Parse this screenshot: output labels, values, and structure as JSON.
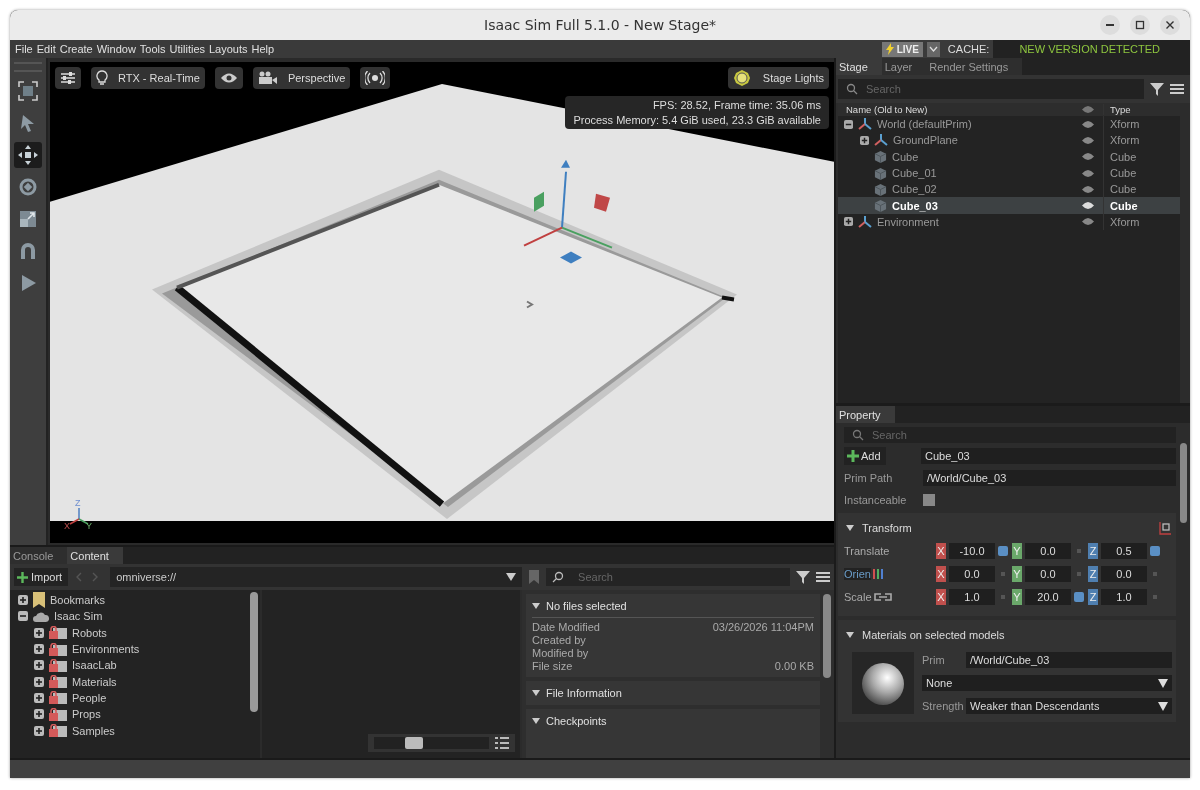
{
  "window": {
    "title": "Isaac Sim Full 5.1.0 - New Stage*"
  },
  "menu": [
    "File",
    "Edit",
    "Create",
    "Window",
    "Tools",
    "Utilities",
    "Layouts",
    "Help"
  ],
  "live": {
    "label": "LIVE"
  },
  "cache": {
    "label": "CACHE:",
    "status": "NEW VERSION DETECTED"
  },
  "tools": [
    {
      "kind": "frame",
      "selected": false
    },
    {
      "kind": "select",
      "selected": false
    },
    {
      "kind": "move",
      "selected": true
    },
    {
      "kind": "rotate",
      "selected": false
    },
    {
      "kind": "scale",
      "selected": false
    },
    {
      "kind": "snap",
      "selected": false
    },
    {
      "kind": "play",
      "selected": false
    }
  ],
  "viewport": {
    "toolbar": [
      {
        "kind": "settings"
      },
      {
        "kind": "render",
        "label": "RTX - Real-Time"
      },
      {
        "kind": "eye"
      },
      {
        "kind": "camera",
        "label": "Perspective"
      },
      {
        "kind": "audio"
      }
    ],
    "stage_lights": "Stage Lights",
    "stats": [
      "FPS: 28.52, Frame time: 35.06 ms",
      "Process Memory: 5.4 GiB used, 23.3 GiB available"
    ],
    "axes": [
      "X",
      "Y",
      "Z"
    ]
  },
  "stage": {
    "tabs": [
      {
        "label": "Stage",
        "selected": true
      },
      {
        "label": "Layer",
        "selected": false
      },
      {
        "label": "Render Settings",
        "selected": false
      }
    ],
    "search": {
      "placeholder": "Search"
    },
    "columns": [
      "Name (Old to New)",
      "Type"
    ],
    "tree": [
      {
        "name": "World (defaultPrim)",
        "type": "Xform",
        "kind": "xform",
        "expanded": true,
        "selected": false,
        "children": [
          {
            "name": "GroundPlane",
            "type": "Xform",
            "kind": "xform",
            "expanded": false,
            "selected": false
          },
          {
            "name": "Cube",
            "type": "Cube",
            "kind": "cube",
            "selected": false
          },
          {
            "name": "Cube_01",
            "type": "Cube",
            "kind": "cube",
            "selected": false
          },
          {
            "name": "Cube_02",
            "type": "Cube",
            "kind": "cube",
            "selected": false
          },
          {
            "name": "Cube_03",
            "type": "Cube",
            "kind": "cube",
            "selected": true
          }
        ]
      },
      {
        "name": "Environment",
        "type": "Xform",
        "kind": "xform",
        "expanded": false,
        "selected": false
      }
    ]
  },
  "property": {
    "tab": "Property",
    "search": {
      "placeholder": "Search"
    },
    "add": "Add",
    "name": "Cube_03",
    "prim_path_label": "Prim Path",
    "prim_path": "/World/Cube_03",
    "instanceable_label": "Instanceable",
    "instanceable": false,
    "transform": {
      "title": "Transform",
      "expanded": true,
      "rows": [
        {
          "label": "Translate",
          "kind": "plain",
          "fields": [
            {
              "axis": "X",
              "value": "-10.0",
              "color": "#c0504d",
              "changed": true
            },
            {
              "axis": "Y",
              "value": "0.0",
              "color": "#6aa86a",
              "changed": false
            },
            {
              "axis": "Z",
              "value": "0.5",
              "color": "#4f7fb0",
              "changed": true
            }
          ]
        },
        {
          "label": "Orien",
          "kind": "orient",
          "fields": [
            {
              "axis": "X",
              "value": "0.0",
              "color": "#c0504d",
              "changed": false
            },
            {
              "axis": "Y",
              "value": "0.0",
              "color": "#6aa86a",
              "changed": false
            },
            {
              "axis": "Z",
              "value": "0.0",
              "color": "#4f7fb0",
              "changed": false
            }
          ]
        },
        {
          "label": "Scale",
          "kind": "scale",
          "fields": [
            {
              "axis": "X",
              "value": "1.0",
              "color": "#c0504d",
              "changed": false
            },
            {
              "axis": "Y",
              "value": "20.0",
              "color": "#6aa86a",
              "changed": true
            },
            {
              "axis": "Z",
              "value": "1.0",
              "color": "#4f7fb0",
              "changed": false
            }
          ]
        }
      ]
    },
    "materials": {
      "title": "Materials on selected models",
      "expanded": true,
      "prim_label": "Prim",
      "prim": "/World/Cube_03",
      "material": "None",
      "strength_label": "Strength",
      "strength": "Weaker than Descendants"
    }
  },
  "content": {
    "tabs": [
      {
        "label": "Console",
        "selected": false
      },
      {
        "label": "Content",
        "selected": true
      }
    ],
    "import": "Import",
    "path": "omniverse://",
    "search": {
      "placeholder": "Search"
    },
    "tree": [
      {
        "name": "Bookmarks",
        "kind": "bookmark",
        "expanded": false
      },
      {
        "name": "Isaac Sim",
        "kind": "cloud",
        "expanded": true,
        "children": [
          {
            "name": "Robots",
            "kind": "folder",
            "expanded": false
          },
          {
            "name": "Environments",
            "kind": "folder",
            "expanded": false
          },
          {
            "name": "IsaacLab",
            "kind": "folder",
            "expanded": false
          },
          {
            "name": "Materials",
            "kind": "folder",
            "expanded": false
          },
          {
            "name": "People",
            "kind": "folder",
            "expanded": false
          },
          {
            "name": "Props",
            "kind": "folder",
            "expanded": false
          },
          {
            "name": "Samples",
            "kind": "folder",
            "expanded": false
          }
        ]
      }
    ],
    "thumbnail_size": {
      "level": 0.35
    },
    "details": {
      "title": "No files selected",
      "expanded": true,
      "rows": [
        {
          "label": "Date Modified",
          "value": "03/26/2026 11:04PM"
        },
        {
          "label": "Created by"
        },
        {
          "label": "Modified by"
        },
        {
          "label": "File size",
          "value": "0.00 KB"
        }
      ]
    },
    "sections": [
      {
        "title": "File Information",
        "expanded": true
      },
      {
        "title": "Checkpoints",
        "expanded": true
      }
    ]
  }
}
